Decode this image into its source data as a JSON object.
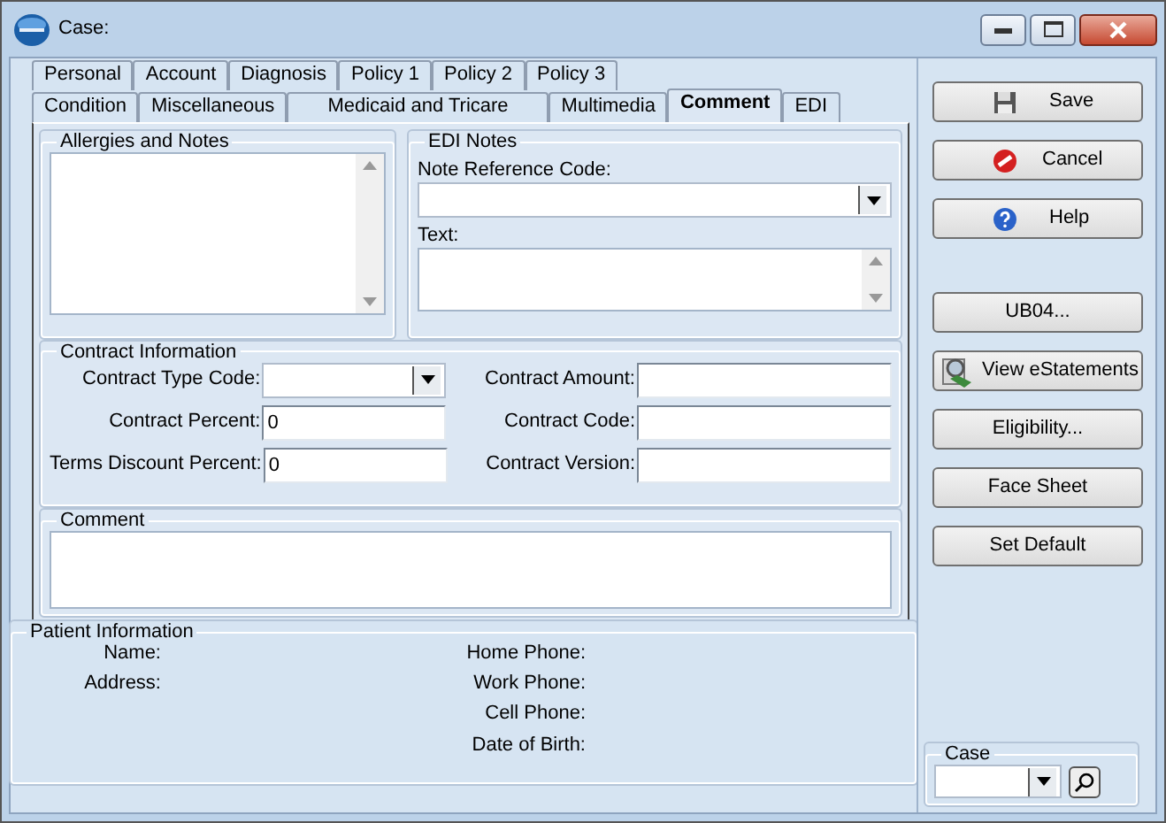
{
  "window": {
    "title": "Case:"
  },
  "tab_rows": [
    [
      {
        "label": "Personal",
        "selected": false
      },
      {
        "label": "Account",
        "selected": false
      },
      {
        "label": "Diagnosis",
        "selected": false
      },
      {
        "label": "Policy 1",
        "selected": false
      },
      {
        "label": "Policy 2",
        "selected": false
      },
      {
        "label": "Policy 3",
        "selected": false
      }
    ],
    [
      {
        "label": "Condition",
        "selected": false
      },
      {
        "label": "Miscellaneous",
        "selected": false
      },
      {
        "label": "Medicaid and Tricare",
        "selected": false
      },
      {
        "label": "Multimedia",
        "selected": false
      },
      {
        "label": "Comment",
        "selected": true
      },
      {
        "label": "EDI",
        "selected": false
      }
    ]
  ],
  "allergies_and_notes": {
    "title": "Allergies and Notes"
  },
  "edi_notes": {
    "title": "EDI Notes",
    "note_reference_code": {
      "label": "Note Reference Code:"
    },
    "text": {
      "label": "Text:"
    }
  },
  "contract_information": {
    "title": "Contract Information",
    "rows": [
      [
        {
          "label": "Contract Type Code:",
          "kind": "dropdown"
        },
        {
          "label": "Contract Amount:",
          "kind": "text"
        }
      ],
      [
        {
          "label": "Contract Percent:",
          "kind": "text",
          "value": "0"
        },
        {
          "label": "Contract Code:",
          "kind": "text"
        }
      ],
      [
        {
          "label": "Terms Discount Percent:",
          "kind": "text",
          "value": "0"
        },
        {
          "label": "Contract Version:",
          "kind": "text"
        }
      ]
    ]
  },
  "comment": {
    "title": "Comment"
  },
  "patient_information": {
    "title": "Patient Information",
    "left": [
      "Name:",
      "Address:"
    ],
    "right": [
      "Home Phone:",
      "Work Phone:",
      "Cell Phone:",
      "Date of Birth:"
    ]
  },
  "buttons": [
    {
      "label": "Save",
      "kind": "save"
    },
    {
      "label": "Cancel",
      "kind": "cancel"
    },
    {
      "label": "Help",
      "kind": "help"
    }
  ],
  "tool_buttons": [
    {
      "label": "UB04...",
      "kind": "plain"
    },
    {
      "label": "View eStatements",
      "kind": "statement"
    },
    {
      "label": "Eligibility...",
      "kind": "plain"
    },
    {
      "label": "Face Sheet",
      "kind": "plain"
    },
    {
      "label": "Set Default",
      "kind": "plain"
    }
  ],
  "case_selector": {
    "label": "Case"
  }
}
